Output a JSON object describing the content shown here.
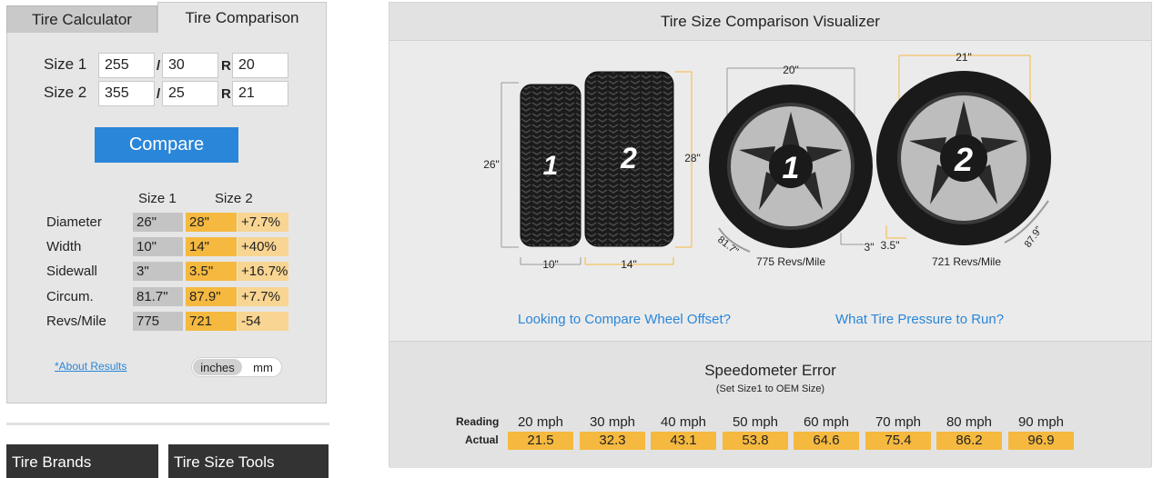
{
  "tabs": {
    "calculator": "Tire Calculator",
    "comparison": "Tire Comparison"
  },
  "sizes": [
    {
      "label": "Size 1",
      "width": "255",
      "aspect": "30",
      "rim": "20"
    },
    {
      "label": "Size 2",
      "width": "355",
      "aspect": "25",
      "rim": "21"
    }
  ],
  "separators": {
    "slash": "/",
    "r": "R"
  },
  "compare_label": "Compare",
  "results": {
    "headers": {
      "size1": "Size 1",
      "size2": "Size 2"
    },
    "rows": [
      {
        "label": "Diameter",
        "size1": "26\"",
        "size2": "28\"",
        "diff": "+7.7%"
      },
      {
        "label": "Width",
        "size1": "10\"",
        "size2": "14\"",
        "diff": "+40%"
      },
      {
        "label": "Sidewall",
        "size1": "3\"",
        "size2": "3.5\"",
        "diff": "+16.7%"
      },
      {
        "label": "Circum.",
        "size1": "81.7\"",
        "size2": "87.9\"",
        "diff": "+7.7%"
      },
      {
        "label": "Revs/Mile",
        "size1": "775",
        "size2": "721",
        "diff": "-54"
      }
    ]
  },
  "about_link": "*About Results",
  "units": {
    "inches": "inches",
    "mm": "mm",
    "selected": "inches"
  },
  "bottom_buttons": {
    "brands": "Tire Brands",
    "tools": "Tire Size Tools"
  },
  "visualizer": {
    "title": "Tire Size Comparison Visualizer",
    "tire1_number": "1",
    "tire2_number": "2",
    "tire1_diameter": "26\"",
    "tire2_diameter": "28\"",
    "tire1_width": "10\"",
    "tire2_width": "14\"",
    "wheel1_rim": "20\"",
    "wheel2_rim": "21\"",
    "wheel1_sidewall": "3\"",
    "wheel2_sidewall": "3.5\"",
    "wheel1_circ": "81.7\"",
    "wheel2_circ": "87.9\"",
    "wheel1_revs": "775 Revs/Mile",
    "wheel2_revs": "721 Revs/Mile",
    "colors": {
      "size1": "#9a9a9a",
      "size2": "#f5b940"
    }
  },
  "links": {
    "offset": "Looking to Compare Wheel Offset?",
    "pressure": "What Tire Pressure to Run?"
  },
  "speedometer": {
    "title": "Speedometer Error",
    "subtitle": "(Set Size1 to OEM Size)",
    "reading_label": "Reading",
    "actual_label": "Actual",
    "readings": [
      "20 mph",
      "30 mph",
      "40 mph",
      "50 mph",
      "60 mph",
      "70 mph",
      "80 mph",
      "90 mph"
    ],
    "actuals": [
      "21.5",
      "32.3",
      "43.1",
      "53.8",
      "64.6",
      "75.4",
      "86.2",
      "96.9"
    ]
  }
}
